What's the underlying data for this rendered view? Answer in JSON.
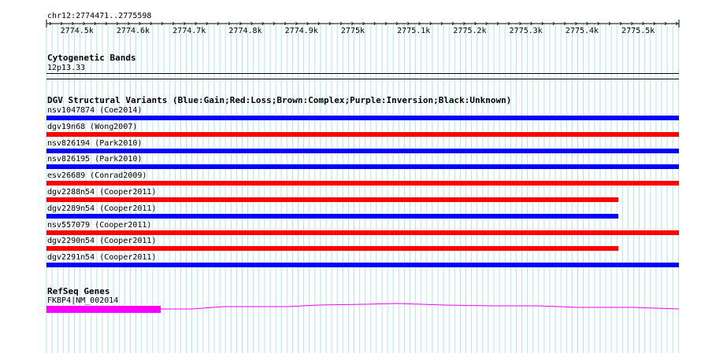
{
  "ruler": {
    "location": "chr12:2774471..2775598",
    "start": 2774471,
    "end": 2775598,
    "ticks": [
      "2774.5k",
      "2774.6k",
      "2774.7k",
      "2774.8k",
      "2774.9k",
      "2775k",
      "2775.1k",
      "2775.2k",
      "2775.3k",
      "2775.4k",
      "2775.5k"
    ]
  },
  "cytoband": {
    "title": "Cytogenetic Bands",
    "band": "12p13.33"
  },
  "dgv": {
    "title": "DGV Structural Variants (Blue:Gain;Red:Loss;Brown:Complex;Purple:Inversion;Black:Unknown)",
    "colors": {
      "gain": "#0000ff",
      "loss": "#ff0000"
    },
    "variants": [
      {
        "label": "nsv1047874 (Coe2014)",
        "type": "gain",
        "extent": 1.0
      },
      {
        "label": "dgv19n68 (Wong2007)",
        "type": "loss",
        "extent": 1.0
      },
      {
        "label": "nsv826194 (Park2010)",
        "type": "gain",
        "extent": 1.0
      },
      {
        "label": "nsv826195 (Park2010)",
        "type": "gain",
        "extent": 1.0
      },
      {
        "label": "esv26689 (Conrad2009)",
        "type": "loss",
        "extent": 1.0
      },
      {
        "label": "dgv2288n54 (Cooper2011)",
        "type": "loss",
        "extent": 0.904
      },
      {
        "label": "dgv2289n54 (Cooper2011)",
        "type": "gain",
        "extent": 0.904
      },
      {
        "label": "nsv557079 (Cooper2011)",
        "type": "loss",
        "extent": 1.0
      },
      {
        "label": "dgv2290n54 (Cooper2011)",
        "type": "loss",
        "extent": 0.904
      },
      {
        "label": "dgv2291n54 (Cooper2011)",
        "type": "gain",
        "extent": 1.0
      }
    ]
  },
  "refseq": {
    "title": "RefSeq Genes",
    "gene": "FKBP4|NM_002014",
    "color": "#ff00ff"
  }
}
